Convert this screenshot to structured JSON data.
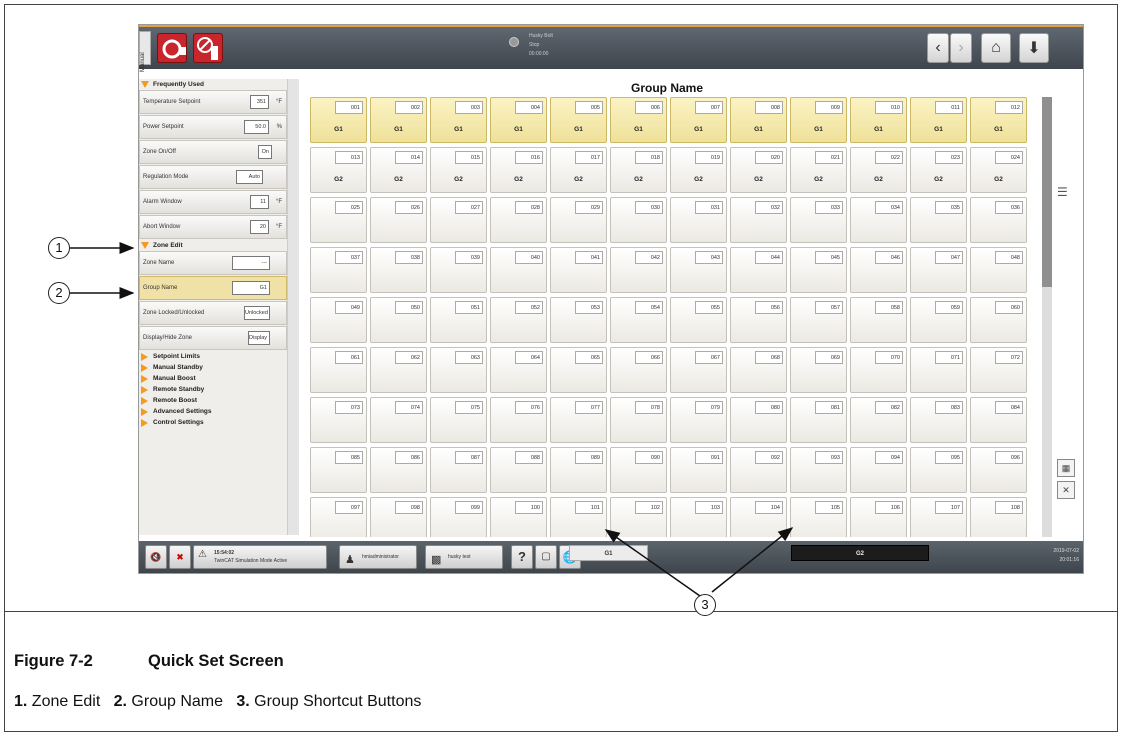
{
  "screen": {
    "manual_tab": "Manual",
    "status_mini": [
      "Husky Bolt",
      "Stop",
      "00:00:00"
    ],
    "main_title": "Group Name",
    "sidebar": {
      "frequently_used": "Frequently Used",
      "rows_freq": [
        {
          "label": "Temperature Setpoint",
          "value": "351",
          "unit": "°F"
        },
        {
          "label": "Power Setpoint",
          "value": "50.0",
          "unit": "%"
        },
        {
          "label": "Zone On/Off",
          "value": "On",
          "unit": ""
        },
        {
          "label": "Regulation Mode",
          "value": "Auto",
          "unit": ""
        },
        {
          "label": "Alarm Window",
          "value": "11",
          "unit": "°F"
        },
        {
          "label": "Abort Window",
          "value": "20",
          "unit": "°F"
        }
      ],
      "zone_edit": "Zone Edit",
      "rows_zone": [
        {
          "label": "Zone Name",
          "value": "---",
          "unit": ""
        },
        {
          "label": "Group Name",
          "value": "G1",
          "unit": ""
        },
        {
          "label": "Zone Locked/Unlocked",
          "value": "Unlocked",
          "unit": ""
        },
        {
          "label": "Display/Hide Zone",
          "value": "Display",
          "unit": ""
        }
      ],
      "collapsed": [
        "Setpoint Limits",
        "Manual Standby",
        "Manual Boost",
        "Remote Standby",
        "Remote Boost",
        "Advanced Settings",
        "Control Settings"
      ]
    },
    "group_rows": [
      "G1",
      "G2",
      "",
      "",
      "",
      "",
      "",
      ""
    ],
    "zone_count": 96,
    "group_shortcuts": [
      "G1",
      "G2"
    ],
    "bottom": {
      "alarm_time": "15:54:02",
      "alarm_text": "TwinCAT Simulation Mode Active",
      "user": "hmiadministrator",
      "mold": "husky test",
      "date": "2019-07-02",
      "time": "20:01:16"
    }
  },
  "callouts": [
    "1",
    "2",
    "3"
  ],
  "caption": {
    "figure_number": "Figure 7-2",
    "figure_title": "Quick Set Screen",
    "legend": [
      {
        "num": "1.",
        "text": "Zone Edit"
      },
      {
        "num": "2.",
        "text": "Group Name"
      },
      {
        "num": "3.",
        "text": "Group Shortcut Buttons"
      }
    ]
  }
}
